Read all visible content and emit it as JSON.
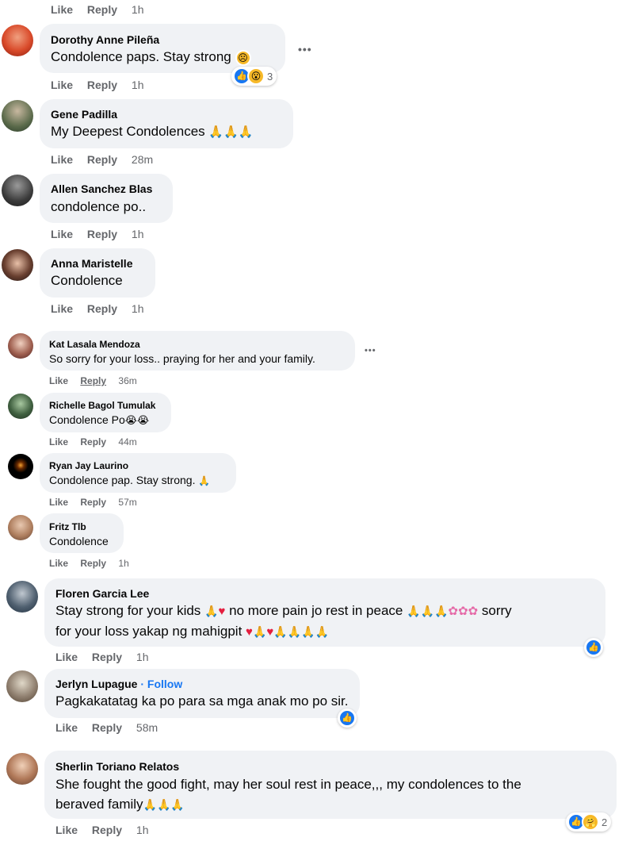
{
  "labels": {
    "like": "Like",
    "reply": "Reply"
  },
  "top_time": "1h",
  "comments": [
    {
      "name": "Dorothy Anne Pileña",
      "text": "Condolence paps. Stay strong",
      "time": "1h",
      "reaction_count": "3"
    },
    {
      "name": "Gene Padilla",
      "text": "My Deepest Condolences",
      "time": "28m"
    },
    {
      "name": "Allen Sanchez Blas",
      "text": "condolence po..",
      "time": "1h"
    },
    {
      "name": "Anna Maristelle",
      "text": "Condolence",
      "time": "1h"
    },
    {
      "name": "Kat Lasala Mendoza",
      "text": "So sorry for your loss.. praying for her and your family.",
      "time": "36m"
    },
    {
      "name": "Richelle Bagol Tumulak",
      "text": "Condolence Po",
      "time": "44m"
    },
    {
      "name": "Ryan Jay Laurino",
      "text": "Condolence pap. Stay strong.",
      "time": "57m"
    },
    {
      "name": "Fritz Tlb",
      "text": "Condolence",
      "time": "1h"
    },
    {
      "name": "Floren Garcia Lee",
      "text_a": "Stay strong for your kids",
      "text_b": "no more pain jo rest in peace",
      "text_c": "sorry",
      "text_d": "for your loss yakap ng mahigpit",
      "time": "1h"
    },
    {
      "name": "Jerlyn Lupague",
      "follow": "· Follow",
      "text": "Pagkakatatag ka po para sa mga anak mo po sir.",
      "time": "58m"
    },
    {
      "name": "Sherlin Toriano Relatos",
      "text_a": "She fought the good fight, may her soul rest in peace,,, my condolences to the",
      "text_b": "beraved family",
      "time": "1h",
      "reaction_count": "2"
    }
  ],
  "icons": {
    "more": "more-options-icon",
    "like_reaction": "like-reaction-icon",
    "wow_reaction": "wow-reaction-icon",
    "care_reaction": "care-reaction-icon",
    "sad_emoji": "sad-emoji-icon",
    "crying_emoji": "crying-emoji-icon",
    "praying_hands": "praying-hands-icon",
    "heart": "heart-icon",
    "flower": "flower-icon"
  },
  "colors": {
    "accent": "#1877f2",
    "bubble": "#f0f2f5",
    "meta": "#65676b"
  }
}
